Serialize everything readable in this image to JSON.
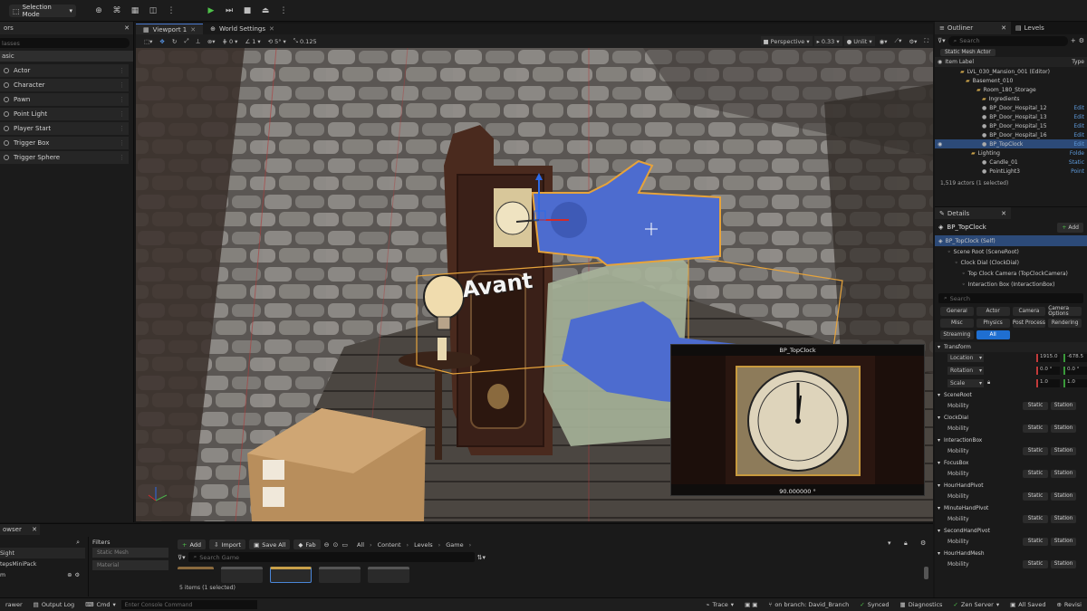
{
  "topbar": {
    "selection_mode": "Selection Mode"
  },
  "left_panel": {
    "tab_label": "ors",
    "search_placeholder": "lasses",
    "category": "asic",
    "items": [
      {
        "label": "Actor"
      },
      {
        "label": "Character"
      },
      {
        "label": "Pawn"
      },
      {
        "label": "Point Light"
      },
      {
        "label": "Player Start"
      },
      {
        "label": "Trigger Box"
      },
      {
        "label": "Trigger Sphere"
      }
    ]
  },
  "viewport": {
    "tabs": [
      {
        "label": "Viewport 1"
      },
      {
        "label": "World Settings"
      }
    ],
    "toolbar": {
      "grid_count": "0",
      "rotation_snap": "5°",
      "rotate_count": "1",
      "scale_snap": "0.125",
      "view_mode": "Perspective",
      "camera_speed": "0.33",
      "lit_mode": "Unlit"
    },
    "overlay_word": "Avant",
    "preview": {
      "title": "BP_TopClock",
      "value": "90.000000 °"
    }
  },
  "outliner": {
    "tabs": [
      {
        "label": "Outliner"
      },
      {
        "label": "Levels"
      }
    ],
    "search_placeholder": "Search",
    "filter_chip": "Static Mesh Actor",
    "col_label": "Item Label",
    "col_type": "Type",
    "rows": [
      {
        "label": "LVL_030_Mansion_001 (Editor)",
        "type": ""
      },
      {
        "label": "Basement_010",
        "type": ""
      },
      {
        "label": "Room_180_Storage",
        "type": ""
      },
      {
        "label": "Ingredients",
        "type": ""
      },
      {
        "label": "BP_Door_Hospital_12",
        "type": "Edit"
      },
      {
        "label": "BP_Door_Hospital_13",
        "type": "Edit"
      },
      {
        "label": "BP_Door_Hospital_15",
        "type": "Edit"
      },
      {
        "label": "BP_Door_Hospital_16",
        "type": "Edit"
      },
      {
        "label": "BP_TopClock",
        "type": "Edit"
      },
      {
        "label": "Lighting",
        "type": "Folde"
      },
      {
        "label": "Candle_01",
        "type": "Static"
      },
      {
        "label": "PointLight3",
        "type": "Point"
      }
    ],
    "footer": "1,519 actors (1 selected)"
  },
  "details": {
    "tab_label": "Details",
    "actor_name": "BP_TopClock",
    "add_label": "Add",
    "components": [
      {
        "label": "BP_TopClock (Self)"
      },
      {
        "label": "Scene Root (SceneRoot)"
      },
      {
        "label": "Clock Dial (ClockDial)"
      },
      {
        "label": "Top Clock Camera (TopClockCamera)"
      },
      {
        "label": "Interaction Box (InteractionBox)"
      }
    ],
    "search_placeholder": "Search",
    "categories": [
      "General",
      "Actor",
      "Camera",
      "Camera Options",
      "Misc",
      "Physics",
      "Post Process",
      "Rendering",
      "Streaming",
      "All"
    ],
    "transform": {
      "header": "Transform",
      "location_label": "Location",
      "rotation_label": "Rotation",
      "scale_label": "Scale",
      "location": [
        "1915.0",
        "-678.5"
      ],
      "rotation": [
        "0.0 °",
        "0.0 °"
      ],
      "scale": [
        "1.0",
        "1.0"
      ]
    },
    "sections": [
      {
        "name": "SceneRoot",
        "prop": "Mobility",
        "opt1": "Static",
        "opt2": "Station"
      },
      {
        "name": "ClockDial",
        "prop": "Mobility",
        "opt1": "Static",
        "opt2": "Station"
      },
      {
        "name": "InteractionBox",
        "prop": "Mobility",
        "opt1": "Static",
        "opt2": "Station"
      },
      {
        "name": "FocusBox",
        "prop": "Mobility",
        "opt1": "Static",
        "opt2": "Station"
      },
      {
        "name": "HourHandPivot",
        "prop": "Mobility",
        "opt1": "Static",
        "opt2": "Station"
      },
      {
        "name": "MinuteHandPivot",
        "prop": "Mobility",
        "opt1": "Static",
        "opt2": "Station"
      },
      {
        "name": "SecondHandPivot",
        "prop": "Mobility",
        "opt1": "Static",
        "opt2": "Station"
      },
      {
        "name": "HourHandMesh",
        "prop": "Mobility",
        "opt1": "Static",
        "opt2": "Station"
      }
    ]
  },
  "content_browser": {
    "tab_label": "owser",
    "tree": [
      {
        "label": "Sight"
      },
      {
        "label": "tepsMiniPack"
      },
      {
        "label": "m"
      }
    ],
    "filters_label": "Filters",
    "filters": [
      {
        "label": "Static Mesh"
      },
      {
        "label": "Material"
      }
    ],
    "add_label": "Add",
    "import_label": "Import",
    "save_all_label": "Save All",
    "fab_label": "Fab",
    "path": [
      "All",
      "Content",
      "Levels",
      "Game"
    ],
    "search_placeholder": "Search Game",
    "items_count": "5 items (1 selected)"
  },
  "statusbar": {
    "drawer": "rawer",
    "output_log": "Output Log",
    "cmd": "Cmd",
    "console_placeholder": "Enter Console Command",
    "trace": "Trace",
    "branch": "on branch: David_Branch",
    "synced": "Synced",
    "diagnostics": "Diagnostics",
    "zen": "Zen Server",
    "all_saved": "All Saved",
    "revision": "Revisi"
  }
}
